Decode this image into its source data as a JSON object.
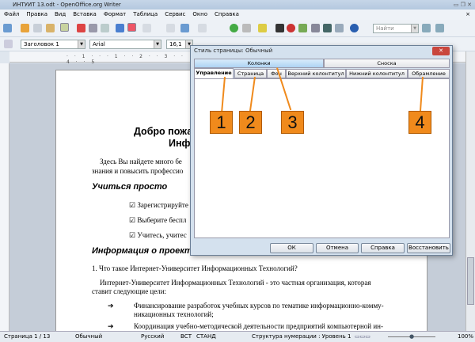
{
  "window": {
    "title": "ИНТУИТ 13.odt - OpenOffice.org Writer"
  },
  "menu": [
    "Файл",
    "Правка",
    "Вид",
    "Вставка",
    "Формат",
    "Таблица",
    "Сервис",
    "Окно",
    "Справка"
  ],
  "toolbar": {
    "paragraph_style": "Заголовок 1",
    "font": "Arial",
    "font_size": "16,1",
    "find_placeholder": "Найти"
  },
  "document": {
    "heading1": "Добро пожа",
    "heading1b": "Инф",
    "intro1": "Здесь Вы найдете много бе",
    "intro2": "знания и повысить профессио",
    "section1": "Учиться просто",
    "checks": [
      "Зарегистрируйте",
      "Выберите беспл",
      "Учитесь, учитес"
    ],
    "section2": "Информация о проекте",
    "q1": "1.  Что такое Интернет-Университет Информационных Технологий?",
    "p1": "Интернет-Университет Информационных Технологий - это частная организация, которая",
    "p1b": "ставит следующие цели:",
    "bullets": [
      "Финансирование разработок учебных курсов по тематике информационно-комму-",
      "никационных технологий;",
      "Координация учебно-методической деятельности предприятий компьютерной ин-"
    ]
  },
  "dialog": {
    "title": "Стиль страницы: Обычный",
    "tabs_row1": [
      "Колонки",
      "Сноска"
    ],
    "tabs_row2": [
      "Управление",
      "Страница",
      "Фон",
      "Верхний колонтитул",
      "Нижний колонтитул",
      "Обрамление"
    ],
    "buttons": {
      "ok": "ОК",
      "cancel": "Отмена",
      "help": "Справка",
      "reset": "Восстановить"
    },
    "callouts": [
      "1",
      "2",
      "3",
      "4"
    ]
  },
  "status": {
    "page": "Страница 1 / 13",
    "style": "Обычный",
    "language": "Русский",
    "insert": "ВСТ",
    "selection": "СТАНД",
    "outline": "Структура нумерации : Уровень 1",
    "zoom": "100%"
  },
  "colors": {
    "accent": "#f08a1c"
  }
}
